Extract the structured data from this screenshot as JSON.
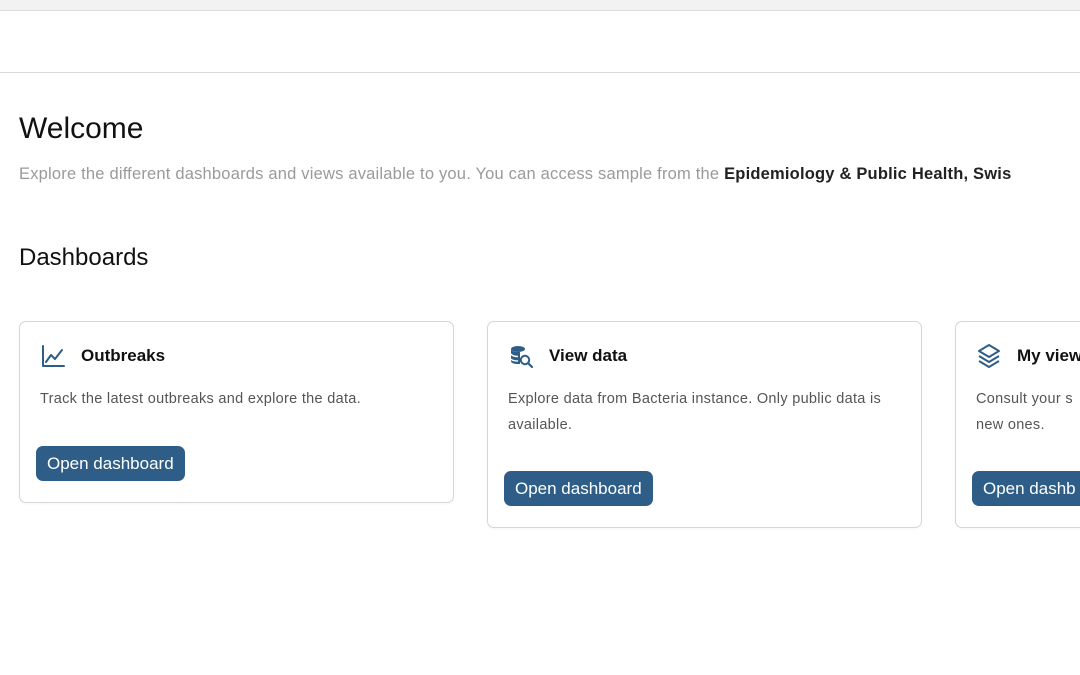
{
  "header": {},
  "welcome": {
    "title": "Welcome",
    "subtitle_prefix": "Explore the different dashboards and views available to you. You can access sample from the ",
    "subtitle_bold": "Epidemiology & Public Health, Swis"
  },
  "dashboards": {
    "title": "Dashboards",
    "cards": [
      {
        "icon": "line-chart-icon",
        "title": "Outbreaks",
        "description": "Track the latest outbreaks and explore the data.",
        "button_label": "Open dashboard"
      },
      {
        "icon": "database-search-icon",
        "title": "View data",
        "description": "Explore data from Bacteria instance. Only public data is available.",
        "button_label": "Open dashboard"
      },
      {
        "icon": "layers-icon",
        "title": "My view",
        "description": "Consult your s new ones.",
        "button_label": "Open dashb"
      }
    ]
  },
  "colors": {
    "accent": "#2e5e87",
    "muted_text": "#9a9a9a",
    "border": "#d6d6d6"
  }
}
